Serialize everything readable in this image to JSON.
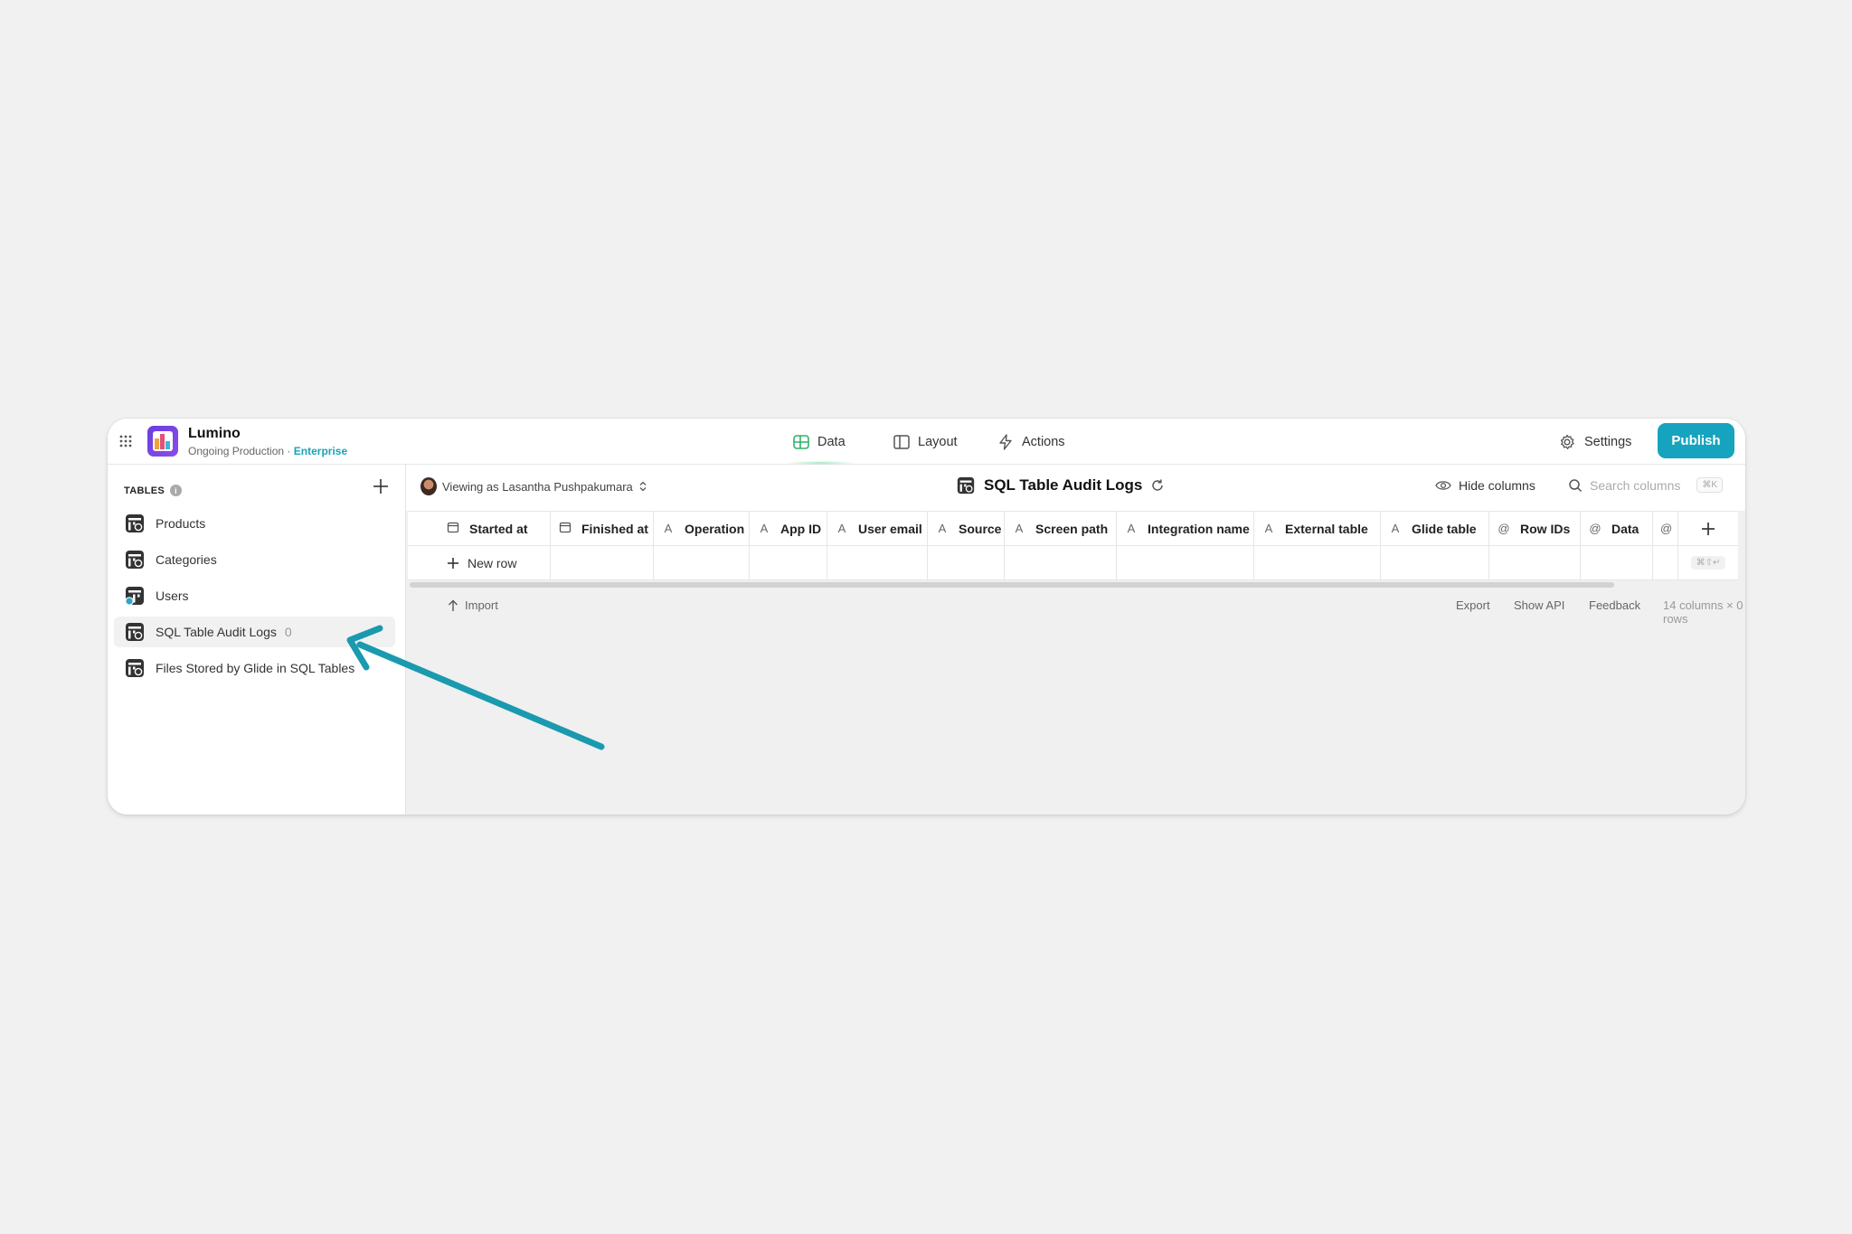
{
  "app": {
    "name": "Lumino",
    "subtitle": "Ongoing Production",
    "separator": "·",
    "plan": "Enterprise"
  },
  "nav": {
    "data": "Data",
    "layout": "Layout",
    "actions": "Actions",
    "active": "Data"
  },
  "header": {
    "settings": "Settings",
    "publish": "Publish"
  },
  "sidebar": {
    "heading": "TABLES",
    "info": "i",
    "items": [
      {
        "label": "Products",
        "count": ""
      },
      {
        "label": "Categories",
        "count": ""
      },
      {
        "label": "Users",
        "count": ""
      },
      {
        "label": "SQL Table Audit Logs",
        "count": "0"
      },
      {
        "label": "Files Stored by Glide in SQL Tables",
        "count": ""
      }
    ],
    "selected_index": 3
  },
  "toolbar": {
    "viewing_as": "Viewing as Lasantha Pushpakumara",
    "table_title": "SQL Table Audit Logs",
    "hide_columns": "Hide columns",
    "search_placeholder": "Search columns",
    "search_shortcut": "⌘K"
  },
  "table": {
    "columns": [
      {
        "type": "cal",
        "label": "Started at"
      },
      {
        "type": "cal",
        "label": "Finished at"
      },
      {
        "type": "A",
        "label": "Operation"
      },
      {
        "type": "A",
        "label": "App ID"
      },
      {
        "type": "A",
        "label": "User email"
      },
      {
        "type": "A",
        "label": "Source"
      },
      {
        "type": "A",
        "label": "Screen path"
      },
      {
        "type": "A",
        "label": "Integration name"
      },
      {
        "type": "A",
        "label": "External table"
      },
      {
        "type": "A",
        "label": "Glide table"
      },
      {
        "type": "@",
        "label": "Row IDs"
      },
      {
        "type": "@",
        "label": "Data"
      },
      {
        "type": "@",
        "label": ""
      }
    ],
    "new_row": "New row",
    "shortcut": "⌘⇧↵"
  },
  "footer": {
    "import": "Import",
    "export": "Export",
    "show_api": "Show API",
    "feedback": "Feedback",
    "summary": "14 columns × 0 rows"
  },
  "colors": {
    "accent": "#16a3bd",
    "arrow": "#1a9aaf",
    "enterprise": "#1aa3b8"
  }
}
